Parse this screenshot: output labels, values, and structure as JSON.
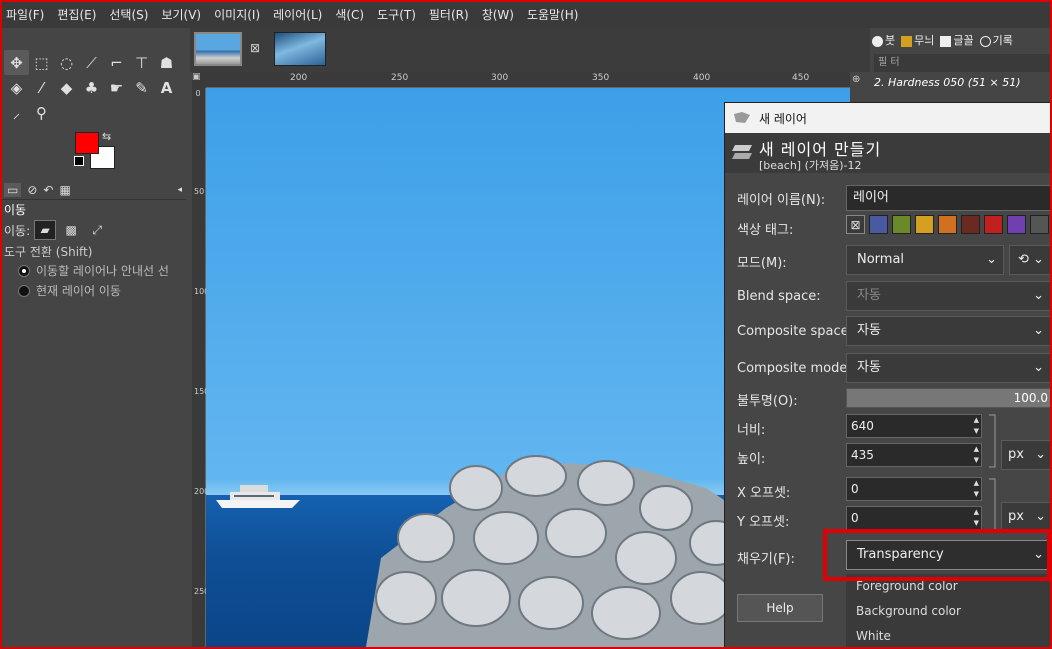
{
  "menu": [
    "파일(F)",
    "편집(E)",
    "선택(S)",
    "보기(V)",
    "이미지(I)",
    "레이어(L)",
    "색(C)",
    "도구(T)",
    "필터(R)",
    "창(W)",
    "도움말(H)"
  ],
  "toolbox": {
    "tab_right": "◂",
    "tool_name": "이동",
    "move_label": "이동:",
    "transform_label": "도구 전환 (Shift)",
    "radio_1": "이동할 레이어나 안내선 선",
    "radio_2": "현재 레이어 이동",
    "colors": {
      "foreground": "#ff0000",
      "background": "#ffffff"
    }
  },
  "canvas": {
    "ruler_top": [
      "200",
      "250",
      "300",
      "350",
      "400",
      "450"
    ],
    "ruler_left": [
      "0",
      "50",
      "100",
      "150",
      "200",
      "250"
    ],
    "image_tab_close": "⊠"
  },
  "dock": {
    "tab_brush": "붓",
    "tab_pattern": "무늬",
    "tab_font": "글꼴",
    "tab_history": "기록",
    "filter_placeholder": "필 터",
    "brush_name": "2. Hardness 050 (51 × 51)"
  },
  "dialog": {
    "window_title": "새 레이어",
    "header_title": "새 레이어 만들기",
    "header_subtitle": "[beach] (가져옴)-12",
    "name_label": "레이어 이름(N):",
    "name_value": "레이어",
    "color_tag_label": "색상 태그:",
    "color_tags": [
      "#4a5aa0",
      "#6a8a2a",
      "#d4a020",
      "#d07020",
      "#6a2a20",
      "#c02020",
      "#7040b0",
      "#555555"
    ],
    "mode_label": "모드(M):",
    "mode_value": "Normal",
    "blend_label": "Blend space:",
    "blend_value": "자동",
    "composite_space_label": "Composite space:",
    "composite_space_value": "자동",
    "composite_mode_label": "Composite mode:",
    "composite_mode_value": "자동",
    "opacity_label": "불투명(O):",
    "opacity_value": "100.0",
    "width_label": "너비:",
    "width_value": "640",
    "height_label": "높이:",
    "height_value": "435",
    "size_unit": "px",
    "x_label": "X 오프셋:",
    "x_value": "0",
    "y_label": "Y 오프셋:",
    "y_value": "0",
    "offset_unit": "px",
    "fill_label": "채우기(F):",
    "fill_value": "Transparency",
    "fill_options": [
      "Foreground color",
      "Background color",
      "White"
    ],
    "help_label": "Help"
  }
}
